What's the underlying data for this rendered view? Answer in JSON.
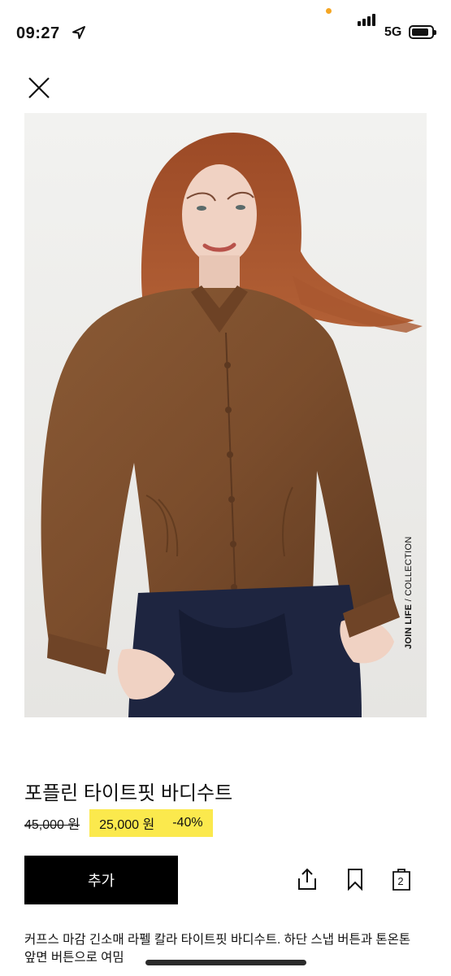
{
  "status_bar": {
    "time": "09:27",
    "network": "5G",
    "icons": [
      "location-arrow-icon",
      "signal-bars-icon",
      "battery-icon"
    ],
    "dot_color": "#f5a623"
  },
  "navigation": {
    "close_icon": "close-icon"
  },
  "product": {
    "image": {
      "description_icon": "model-photo",
      "collection_prefix": "JOIN LIFE",
      "collection_suffix": " / COLLECTION",
      "background_color": "#ededeb"
    },
    "title": "포플린 타이트핏 바디수트",
    "original_price": "45,000 원",
    "sale_price": "25,000 원",
    "discount": "-40%",
    "sale_highlight_color": "#fbe94d",
    "description": "커프스 마감 긴소매 라펠 칼라 타이트핏 바디수트. 하단 스냅 버튼과 톤온톤 앞면 버튼으로 여밈"
  },
  "actions": {
    "add_label": "추가",
    "share_icon": "share-icon",
    "bookmark_icon": "bookmark-icon",
    "cart_icon": "shopping-bag-icon",
    "cart_count": "2"
  }
}
